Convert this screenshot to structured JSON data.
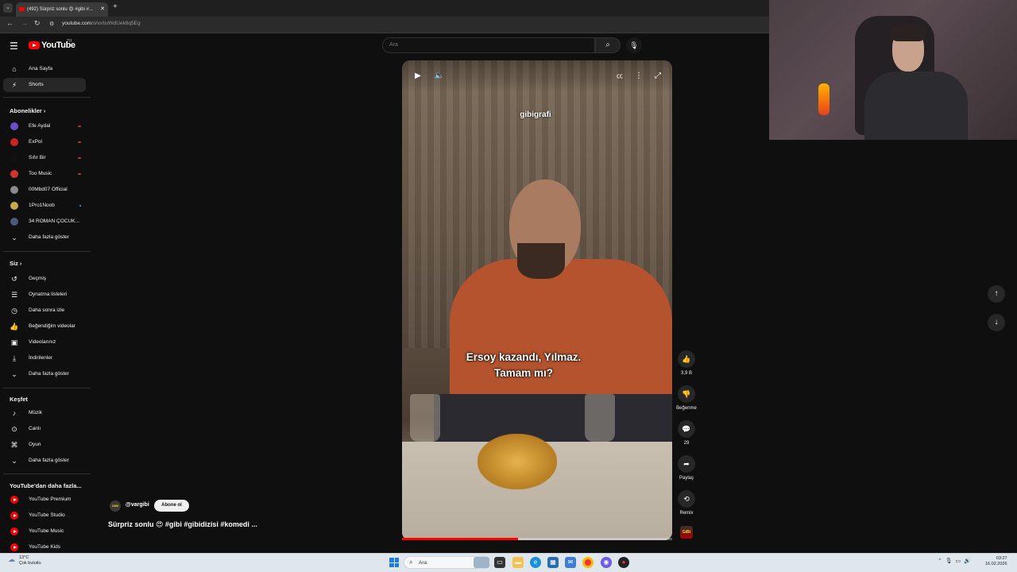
{
  "browser": {
    "tab_title": "(492) Sürpriz sonlu 😍 #gibi #...",
    "tab_close": "✕",
    "new_tab": "+",
    "url_host": "youtube.com",
    "url_path": "/shorts/WdUek8q5Eg"
  },
  "header": {
    "logo_text": "YouTube",
    "region": "TR",
    "search_placeholder": "Ara"
  },
  "sidebar": {
    "main": [
      {
        "label": "Ana Sayfa",
        "icon": "home-icon"
      },
      {
        "label": "Shorts",
        "icon": "shorts-icon"
      }
    ],
    "subscriptions_title": "Abonelikler",
    "subscriptions": [
      {
        "label": "Efe Aydal",
        "color": "#6a4fc8",
        "badge": "live"
      },
      {
        "label": "ExPol",
        "color": "#cc2222",
        "badge": "live"
      },
      {
        "label": "Sıfır Bir",
        "color": "#111111",
        "badge": "live"
      },
      {
        "label": "Too Music",
        "color": "#d0342c",
        "badge": "live"
      },
      {
        "label": "00Mbd07 Official",
        "color": "#8a8a8a",
        "badge": ""
      },
      {
        "label": "1Pro1Noob",
        "color": "#c9a84a",
        "badge": "new"
      },
      {
        "label": "34 ROMAN ÇOCUK...",
        "color": "#4a5a7a",
        "badge": ""
      }
    ],
    "subs_more": "Daha fazla göster",
    "you_title": "Siz",
    "you": [
      {
        "label": "Geçmiş",
        "icon": "history-icon",
        "glyph": "↺"
      },
      {
        "label": "Oynatma listeleri",
        "icon": "playlists-icon",
        "glyph": "☰"
      },
      {
        "label": "Daha sonra izle",
        "icon": "watch-later-icon",
        "glyph": "◷"
      },
      {
        "label": "Beğendiğim videolar",
        "icon": "liked-videos-icon",
        "glyph": "👍"
      },
      {
        "label": "Videolarınız",
        "icon": "your-videos-icon",
        "glyph": "▣"
      },
      {
        "label": "İndirilenler",
        "icon": "downloads-icon",
        "glyph": "⤓"
      }
    ],
    "you_more": "Daha fazla göster",
    "explore_title": "Keşfet",
    "explore": [
      {
        "label": "Müzik",
        "icon": "music-icon",
        "glyph": "♪"
      },
      {
        "label": "Canlı",
        "icon": "live-icon",
        "glyph": "⊙"
      },
      {
        "label": "Oyun",
        "icon": "gaming-icon",
        "glyph": "⌘"
      }
    ],
    "explore_more": "Daha fazla göster",
    "more_from_title": "YouTube'dan daha fazla...",
    "more_from": [
      {
        "label": "YouTube Premium"
      },
      {
        "label": "YouTube Studio"
      },
      {
        "label": "YouTube Music"
      },
      {
        "label": "YouTube Kids"
      }
    ]
  },
  "video": {
    "watermark": "gibigrafi",
    "subtitle_line1": "Ersoy kazandı, Yılmaz.",
    "subtitle_line2": "Tamam mı?",
    "progress": 0.43
  },
  "actions": {
    "like_count": "3,9 B",
    "dislike_label": "Beğenme",
    "comment_count": "29",
    "share_label": "Paylaş",
    "remix_label": "Remix",
    "remix_thumb_text": "GiBi"
  },
  "channel": {
    "handle": "@vargibi",
    "avatar_text": "GiBi",
    "subscribe_label": "Abone ol",
    "title": "Sürpriz sonlu 😍 #gibi #gibidizisi #komedi ..."
  },
  "taskbar": {
    "weather_temp": "13°C",
    "weather_desc": "Çok bulutlu",
    "search_placeholder": "Ara",
    "time": "03:27",
    "date": "16.02.2026"
  }
}
